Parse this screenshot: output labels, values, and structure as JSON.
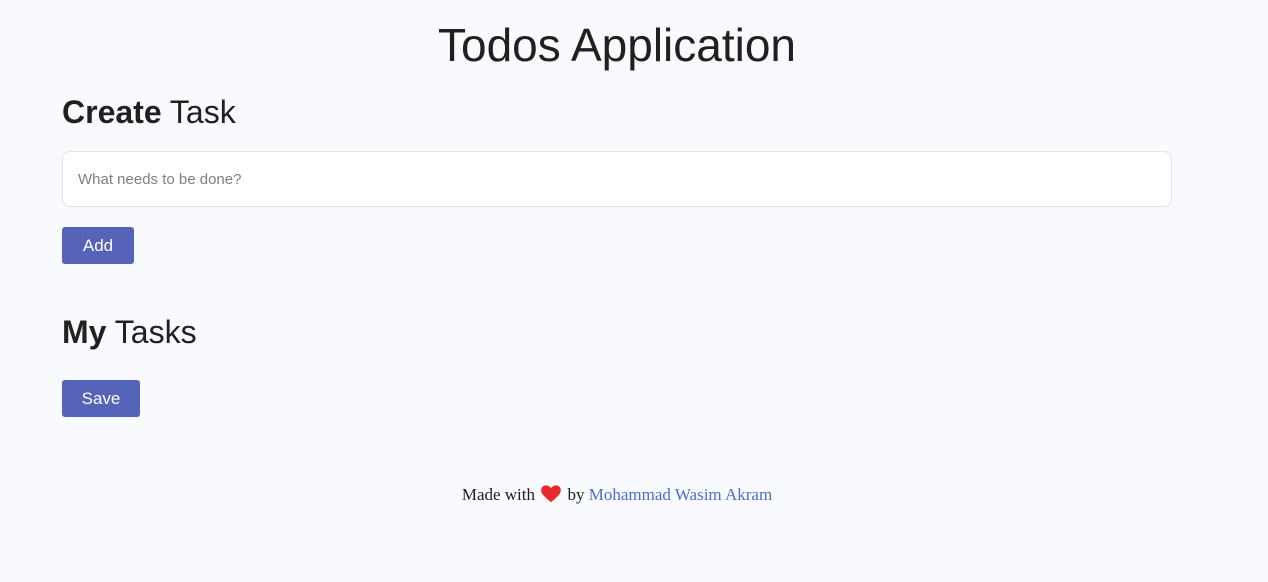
{
  "header": {
    "title": "Todos Application"
  },
  "create": {
    "heading_bold": "Create",
    "heading_rest": " Task",
    "input_placeholder": "What needs to be done?",
    "input_value": "",
    "add_label": "Add"
  },
  "tasks": {
    "heading_bold": "My",
    "heading_rest": " Tasks",
    "save_label": "Save"
  },
  "footer": {
    "made_with": "Made with",
    "heart_icon": "heart-icon",
    "by": "by",
    "author": "Mohammad Wasim Akram"
  },
  "colors": {
    "background": "#f9fafe",
    "button": "#5563b8",
    "link": "#4a6fd1",
    "heart": "#e8282c"
  }
}
